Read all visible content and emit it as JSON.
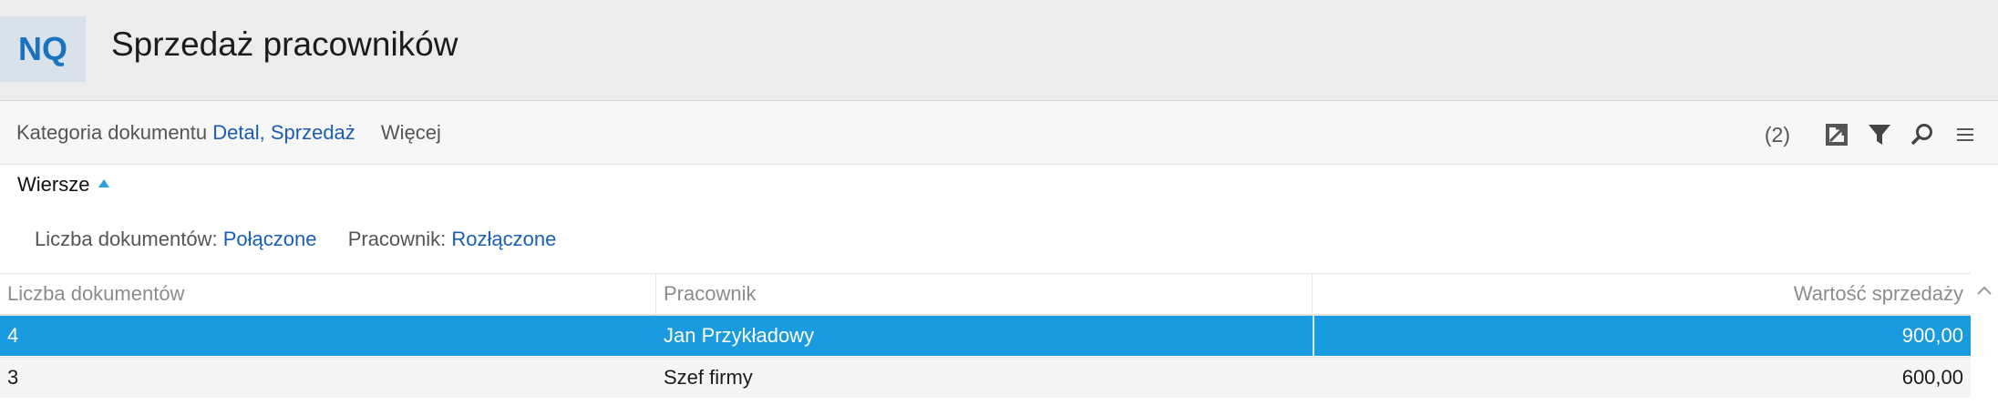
{
  "header": {
    "badge": "NQ",
    "title": "Sprzedaż pracowników"
  },
  "filterbar": {
    "category_label": "Kategoria dokumentu",
    "category_value": "Detal, Sprzedaż",
    "more_label": "Więcej",
    "count": "(2)",
    "tools": [
      "expand-icon",
      "filter-icon",
      "search-icon",
      "menu-icon"
    ]
  },
  "section": {
    "label": "Wiersze"
  },
  "groups": [
    {
      "label": "Liczba dokumentów:",
      "value": "Połączone"
    },
    {
      "label": "Pracownik:",
      "value": "Rozłączone"
    }
  ],
  "table": {
    "columns": [
      "Liczba dokumentów",
      "Pracownik",
      "Wartość sprzedaży"
    ],
    "rows": [
      [
        "4",
        "Jan Przykładowy",
        "900,00"
      ],
      [
        "3",
        "Szef firmy",
        "600,00"
      ]
    ]
  },
  "colors": {
    "accent": "#1a73c0",
    "selected_row": "#1a9be0",
    "link": "#1a5fb4"
  }
}
